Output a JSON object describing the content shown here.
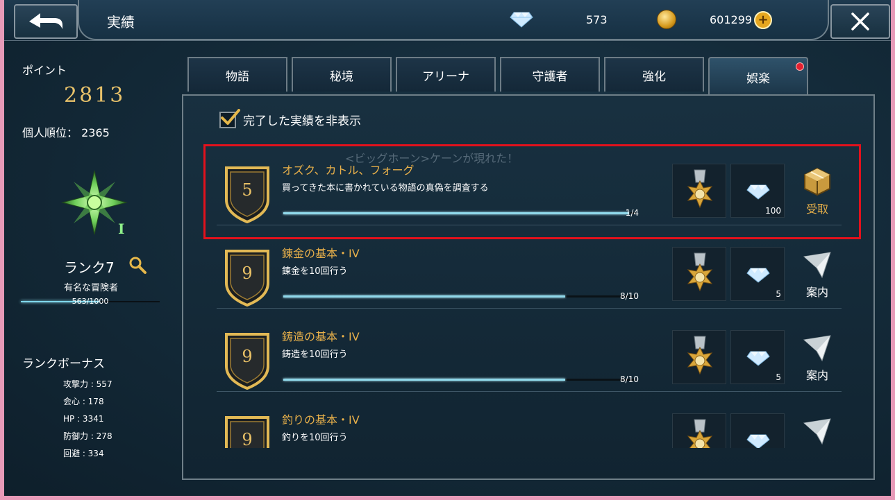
{
  "header": {
    "title": "実績",
    "gems": "573",
    "gold": "601299",
    "icons": {
      "back": "back-arrow-icon",
      "close": "close-icon",
      "gem": "diamond-icon",
      "coin": "gold-coin-icon",
      "plus": "plus-icon"
    }
  },
  "sidebar": {
    "points_label": "ポイント",
    "points_value": "2813",
    "rank_position_label": "個人順位：",
    "rank_position_value": "2365",
    "rank_roman": "I",
    "rank_level": "ランク7",
    "rank_title": "有名な冒険者",
    "xp_text": "563/1000",
    "xp_progress": 0.563,
    "bonus_title": "ランクボーナス",
    "bonus": [
      {
        "text": "攻撃力 : 557"
      },
      {
        "text": "会心 : 178"
      },
      {
        "text": "HP : 3341"
      },
      {
        "text": "防御力 : 278"
      },
      {
        "text": "回避 : 334"
      }
    ]
  },
  "tabs": [
    {
      "label": "物語",
      "active": false
    },
    {
      "label": "秘境",
      "active": false
    },
    {
      "label": "アリーナ",
      "active": false
    },
    {
      "label": "守護者",
      "active": false
    },
    {
      "label": "強化",
      "active": false
    },
    {
      "label": "娯楽",
      "active": true,
      "notification": true
    }
  ],
  "filter": {
    "label": "完了した実績を非表示",
    "checked": true
  },
  "ghost_text": "<ビッグホーン>ケーンが現れた！",
  "achievements": [
    {
      "grade": "5",
      "title": "オズク、カトル、フォーグ",
      "desc": "買ってきた本に書かれている物語の真偽を調査する",
      "progress_text": "1/4",
      "progress": 0.98,
      "gem_reward": "100",
      "action": "受取",
      "action_color": "#e8b04a"
    },
    {
      "grade": "9",
      "title": "錬金の基本・IV",
      "desc": "錬金を10回行う",
      "progress_text": "8/10",
      "progress": 0.8,
      "gem_reward": "5",
      "action": "案内",
      "action_color": "#ffffff"
    },
    {
      "grade": "9",
      "title": "鋳造の基本・IV",
      "desc": "鋳造を10回行う",
      "progress_text": "8/10",
      "progress": 0.8,
      "gem_reward": "5",
      "action": "案内",
      "action_color": "#ffffff"
    },
    {
      "grade": "9",
      "title": "釣りの基本・IV",
      "desc": "釣りを10回行う",
      "progress_text": "",
      "progress": 0,
      "gem_reward": "",
      "action": "",
      "action_color": "#ffffff"
    }
  ]
}
